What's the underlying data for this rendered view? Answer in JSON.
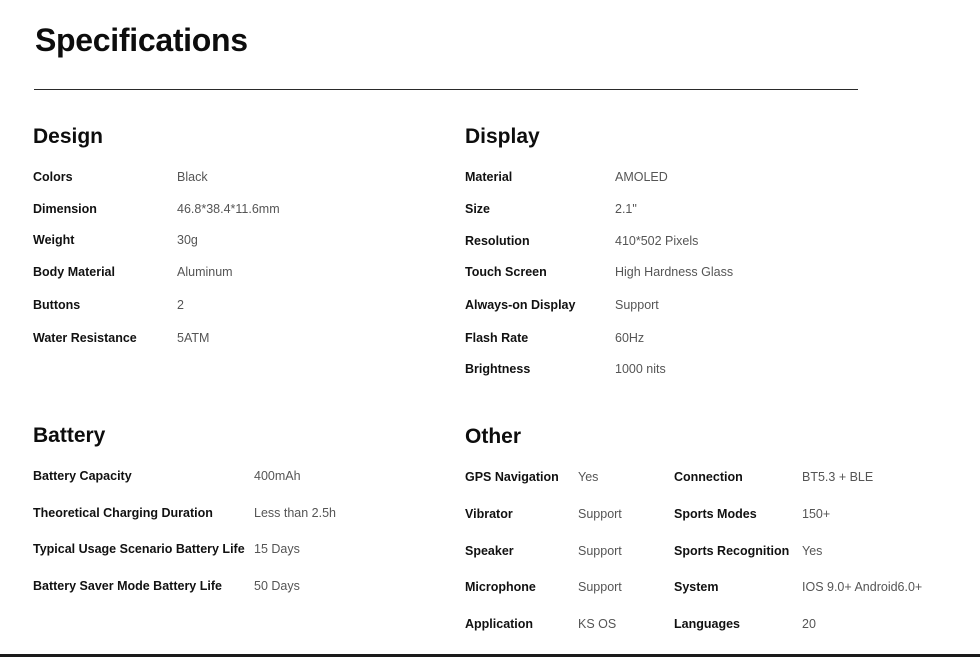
{
  "page_title": "Specifications",
  "design": {
    "heading": "Design",
    "rows": [
      {
        "label": "Colors",
        "value": "Black"
      },
      {
        "label": "Dimension",
        "value": "46.8*38.4*11.6mm"
      },
      {
        "label": "Weight",
        "value": "30g"
      },
      {
        "label": "Body Material",
        "value": "Aluminum"
      },
      {
        "label": "Buttons",
        "value": "2"
      },
      {
        "label": "Water Resistance",
        "value": "5ATM"
      }
    ]
  },
  "display": {
    "heading": "Display",
    "rows": [
      {
        "label": "Material",
        "value": "AMOLED"
      },
      {
        "label": "Size",
        "value": "2.1\""
      },
      {
        "label": "Resolution",
        "value": "410*502 Pixels"
      },
      {
        "label": "Touch Screen",
        "value": "High Hardness Glass"
      },
      {
        "label": "Always-on Display",
        "value": "Support"
      },
      {
        "label": "Flash Rate",
        "value": "60Hz"
      },
      {
        "label": "Brightness",
        "value": "1000 nits"
      }
    ]
  },
  "battery": {
    "heading": "Battery",
    "rows": [
      {
        "label": "Battery Capacity",
        "value": "400mAh"
      },
      {
        "label": "Theoretical Charging Duration",
        "value": "Less than 2.5h"
      },
      {
        "label": "Typical Usage Scenario Battery Life",
        "value": "15 Days"
      },
      {
        "label": "Battery Saver Mode Battery Life",
        "value": "50 Days"
      }
    ]
  },
  "other": {
    "heading": "Other",
    "left_rows": [
      {
        "label": "GPS Navigation",
        "value": "Yes"
      },
      {
        "label": "Vibrator",
        "value": "Support"
      },
      {
        "label": "Speaker",
        "value": "Support"
      },
      {
        "label": "Microphone",
        "value": "Support"
      },
      {
        "label": "Application",
        "value": "KS OS"
      }
    ],
    "right_rows": [
      {
        "label": "Connection",
        "value": "BT5.3 + BLE"
      },
      {
        "label": "Sports Modes",
        "value": "150+"
      },
      {
        "label": "Sports Recognition",
        "value": "Yes"
      },
      {
        "label": "System",
        "value": "IOS 9.0+ Android6.0+"
      },
      {
        "label": "Languages",
        "value": "20"
      }
    ]
  }
}
